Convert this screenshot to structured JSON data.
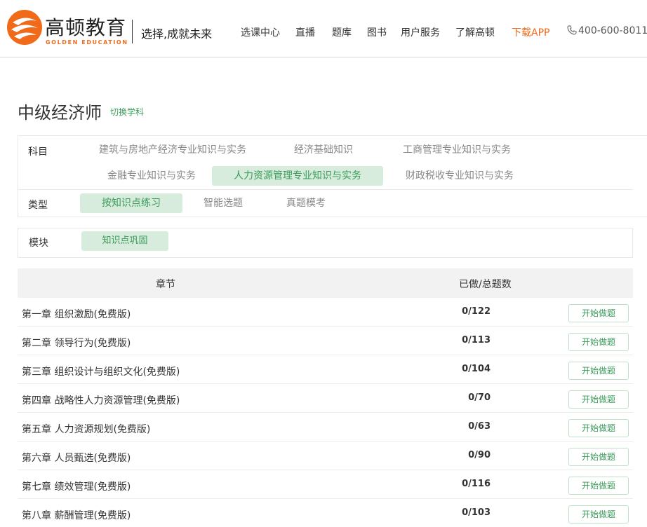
{
  "header": {
    "brand_cn": "高顿教育",
    "brand_en": "GOLDEN EDUCATION",
    "slogan": "选择,成就未来",
    "nav": [
      "选课中心",
      "直播",
      "题库",
      "图书",
      "用户服务",
      "了解高顿",
      "下载APP"
    ],
    "phone": "400-600-8011",
    "accent_color": "#f06a1a"
  },
  "page": {
    "title": "中级经济师",
    "switch_label": "切换学科"
  },
  "filters": {
    "subject_label": "科目",
    "subjects": [
      "建筑与房地产经济专业知识与实务",
      "经济基础知识",
      "工商管理专业知识与实务",
      "金融专业知识与实务",
      "人力资源管理专业知识与实务",
      "财政税收专业知识与实务"
    ],
    "subject_selected": "人力资源管理专业知识与实务",
    "type_label": "类型",
    "types": [
      "按知识点练习",
      "智能选题",
      "真题模考"
    ],
    "type_selected": "按知识点练习",
    "module_label": "模块",
    "modules": [
      "知识点巩固"
    ],
    "module_selected": "知识点巩固"
  },
  "table": {
    "headers": [
      "章节",
      "已做/总题数"
    ],
    "button_label": "开始做题",
    "rows": [
      {
        "chapter": "第一章 组织激励(免费版)",
        "count": "0/122"
      },
      {
        "chapter": "第二章 领导行为(免费版)",
        "count": "0/113"
      },
      {
        "chapter": "第三章 组织设计与组织文化(免费版)",
        "count": "0/104"
      },
      {
        "chapter": "第四章 战略性人力资源管理(免费版)",
        "count": "0/70"
      },
      {
        "chapter": "第五章 人力资源规划(免费版)",
        "count": "0/63"
      },
      {
        "chapter": "第六章 人员甄选(免费版)",
        "count": "0/90"
      },
      {
        "chapter": "第七章 绩效管理(免费版)",
        "count": "0/116"
      },
      {
        "chapter": "第八章 薪酬管理(免费版)",
        "count": "0/103"
      }
    ]
  },
  "colors": {
    "green": "#3a9b5a",
    "green_bg": "#d7ecdc",
    "orange": "#f06a1a"
  }
}
